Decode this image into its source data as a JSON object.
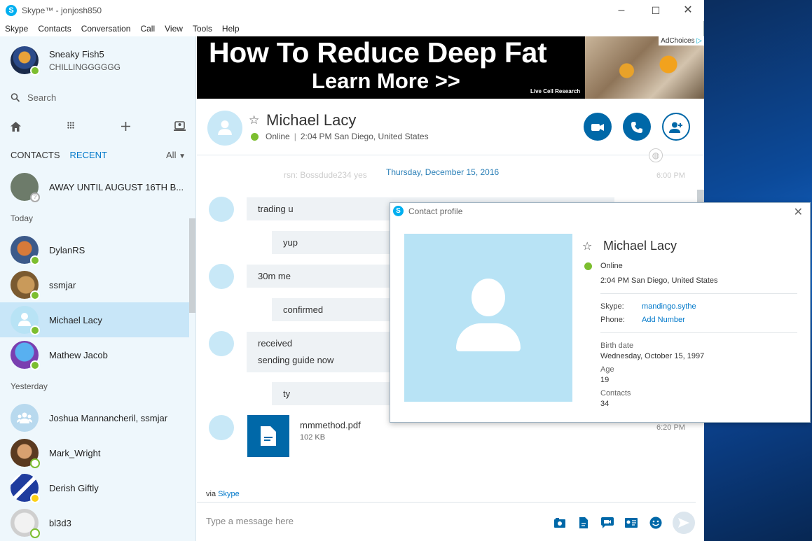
{
  "window": {
    "title": "Skype™ - jonjosh850",
    "controls": {
      "minimize": "–",
      "maximize": "☐",
      "close": "✕"
    }
  },
  "menu": [
    "Skype",
    "Contacts",
    "Conversation",
    "Call",
    "View",
    "Tools",
    "Help"
  ],
  "me": {
    "name": "Sneaky Fish5",
    "mood": "CHILLINGGGGGG"
  },
  "search": {
    "placeholder": "Search"
  },
  "tabs": {
    "contacts": "CONTACTS",
    "recent": "RECENT",
    "filter": "All"
  },
  "sections": {
    "today": "Today",
    "yesterday": "Yesterday"
  },
  "contacts": [
    {
      "name": "AWAY UNTIL AUGUST 16TH B...",
      "status": "unknown",
      "color": "#6d7b6a"
    },
    {
      "name": "DylanRS",
      "status": "online",
      "color": "#3c5a8a"
    },
    {
      "name": "ssmjar",
      "status": "online",
      "color": "#a07c4a"
    },
    {
      "name": "Michael Lacy",
      "status": "online",
      "color": "#c8e8f7"
    },
    {
      "name": "Mathew Jacob",
      "status": "online",
      "color": "#4a90e2"
    },
    {
      "name": "Joshua Mannancheril, ssmjar",
      "status": "none",
      "color": "#b8d9ee"
    },
    {
      "name": "Mark_Wright",
      "status": "offline",
      "color": "#8a5a3a"
    },
    {
      "name": "Derish Giftly",
      "status": "away",
      "color": "#1f3c9e"
    },
    {
      "name": "bl3d3",
      "status": "offline",
      "color": "#dcdcdc"
    }
  ],
  "ad": {
    "headline": "How To Reduce Deep Fat",
    "cta": "Learn More >>",
    "source": "Live Cell Research",
    "adchoices": "AdChoices"
  },
  "chat": {
    "name": "Michael Lacy",
    "status": "Online",
    "location": "2:04 PM San Diego, United States",
    "date_divider": "Thursday, December 15, 2016",
    "faded_line": "rsn: Bossdude234 yes",
    "faded_time": "6:00 PM",
    "messages": [
      "trading u",
      "yup",
      "30m me",
      "confirmed",
      "received",
      "sending guide now",
      "ty"
    ],
    "file": {
      "name": "mmmethod.pdf",
      "size": "102 KB",
      "time": "6:20 PM"
    },
    "via": "via",
    "via_link": "Skype",
    "compose_placeholder": "Type a message here"
  },
  "profile": {
    "title": "Contact profile",
    "name": "Michael Lacy",
    "status": "Online",
    "time_location": "2:04 PM San Diego, United States",
    "skype_label": "Skype:",
    "skype_value": "mandingo.sythe",
    "phone_label": "Phone:",
    "phone_value": "Add Number",
    "birth_label": "Birth date",
    "birth_value": "Wednesday, October 15, 1997",
    "age_label": "Age",
    "age_value": "19",
    "contacts_label": "Contacts",
    "contacts_value": "34"
  },
  "colors": {
    "accent": "#0078ca",
    "button": "#0068a8",
    "online": "#7cbe2f",
    "away": "#fcd116"
  }
}
